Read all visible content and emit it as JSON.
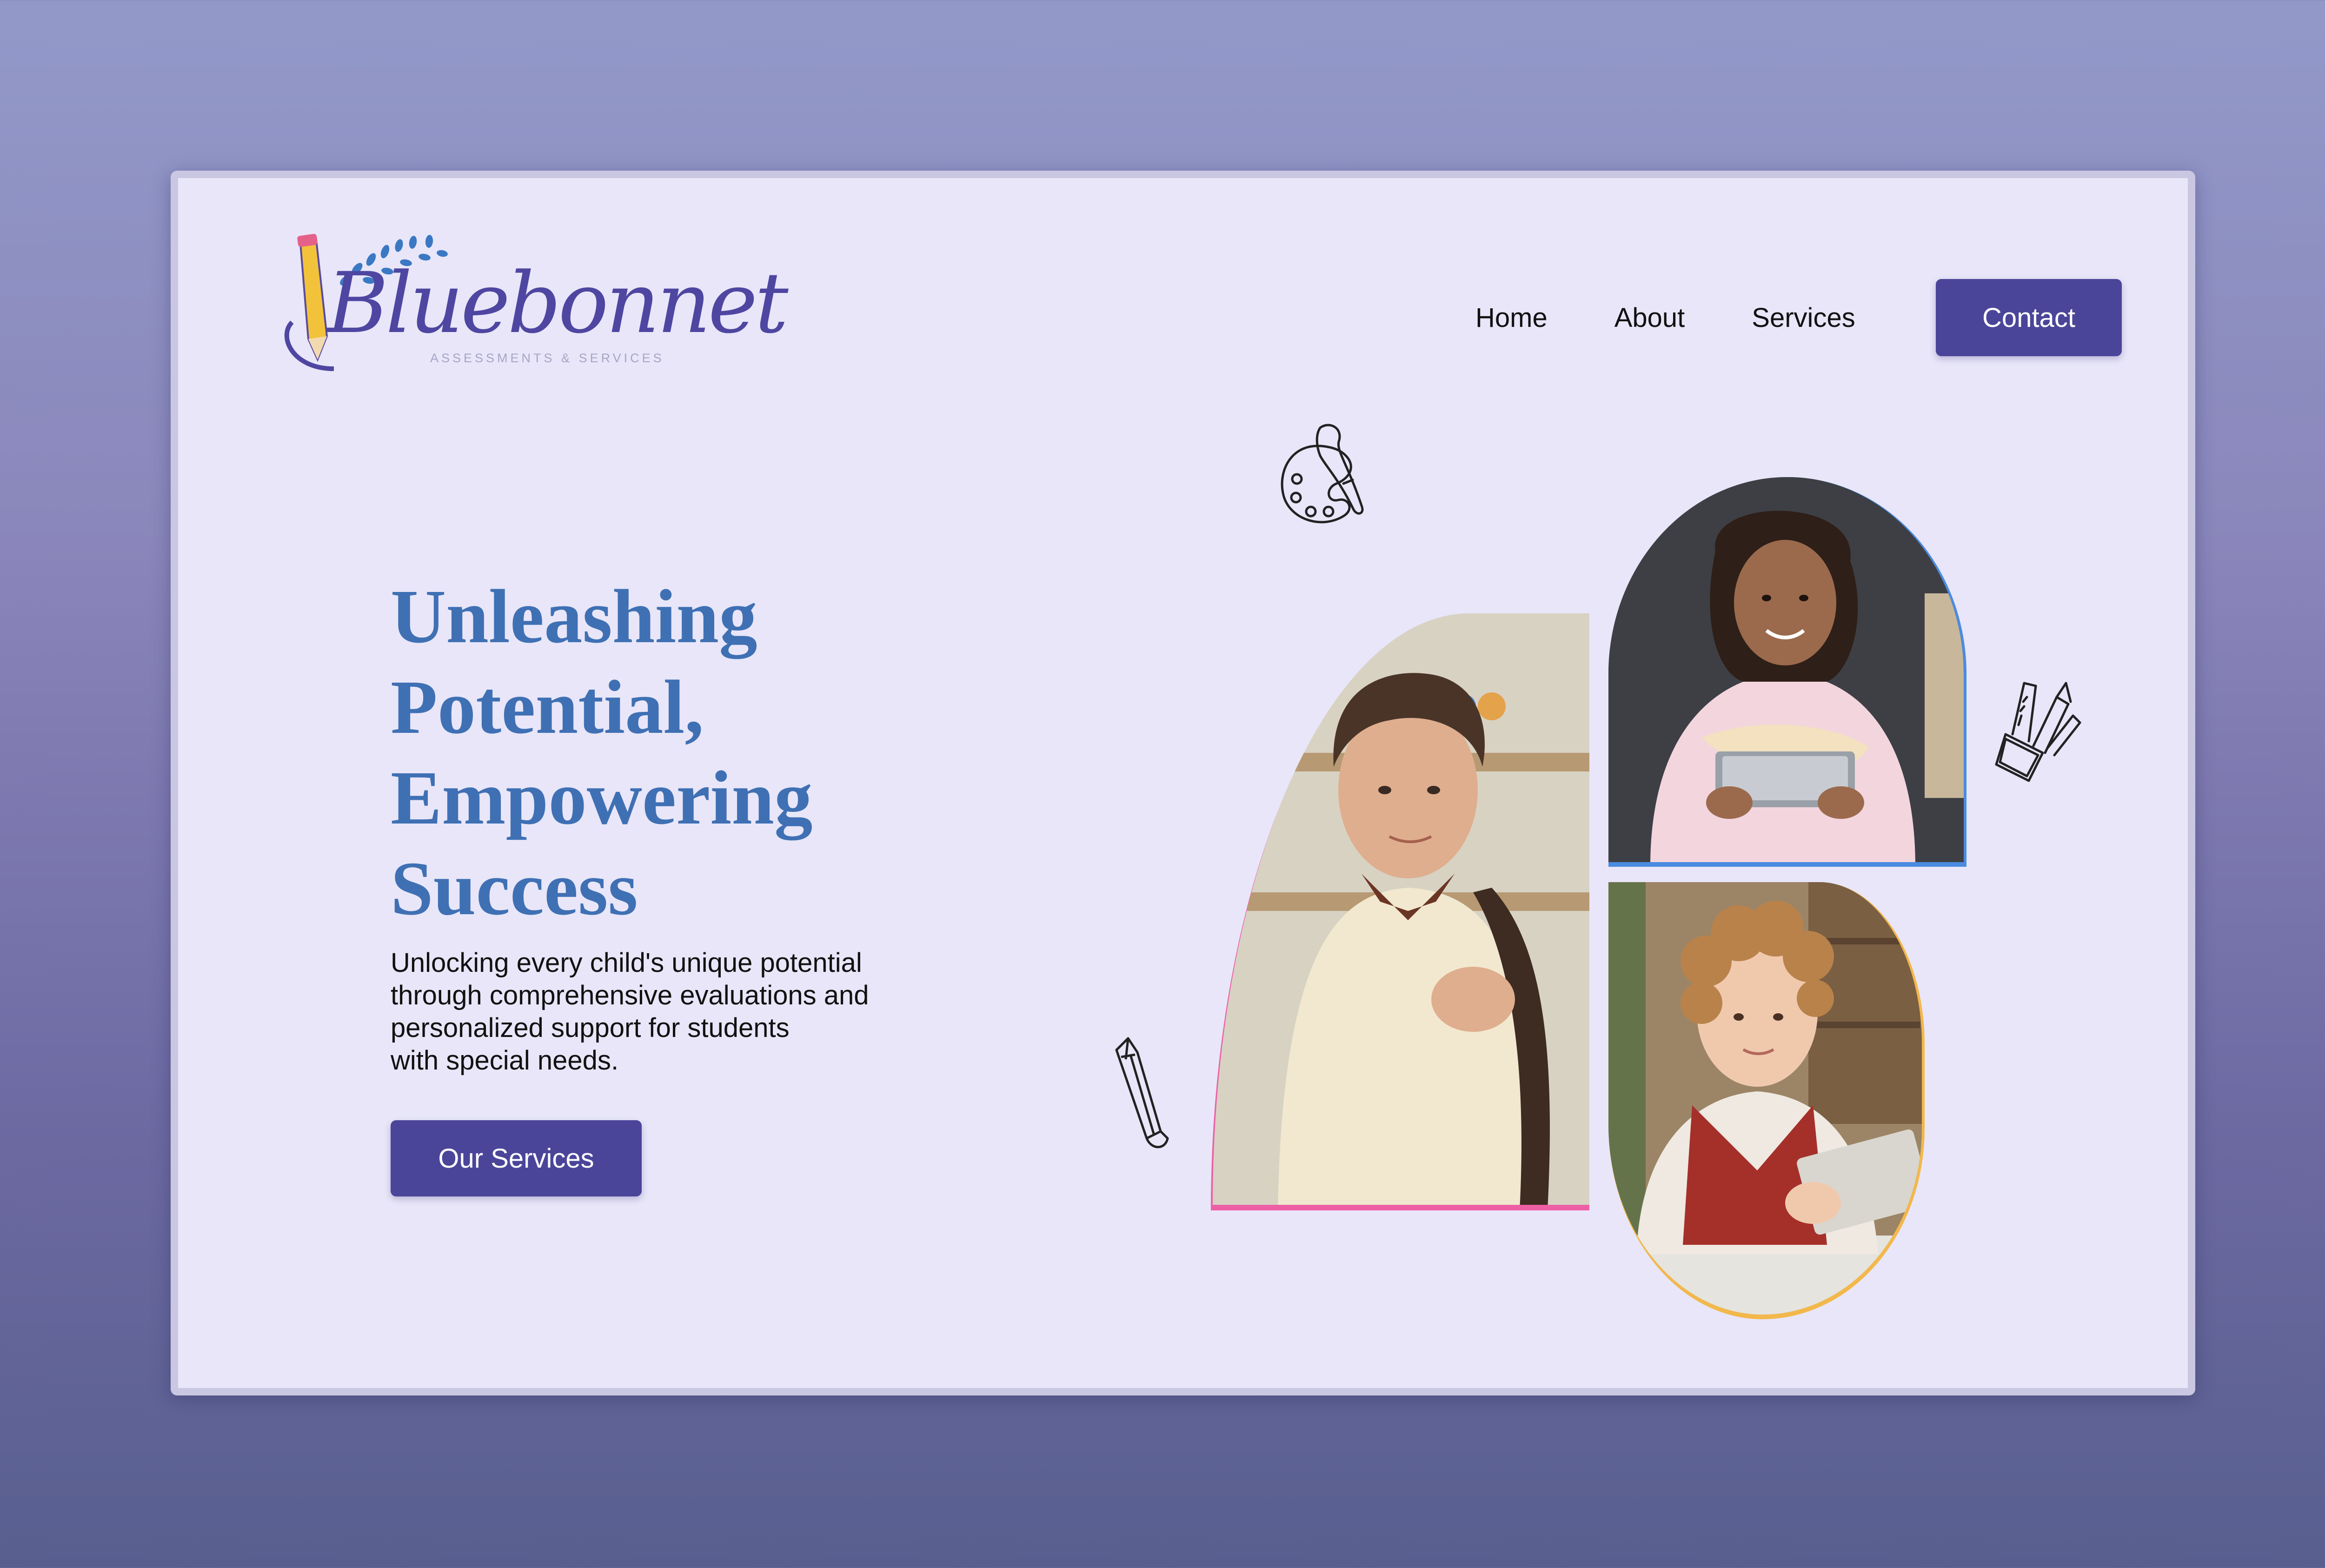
{
  "logo": {
    "wordmark": "Bluebonnet",
    "tagline": "ASSESSMENTS & SERVICES"
  },
  "nav": {
    "items": [
      {
        "label": "Home"
      },
      {
        "label": "About"
      },
      {
        "label": "Services"
      }
    ],
    "cta_label": "Contact"
  },
  "hero": {
    "title_lines": [
      "Unleashing",
      "Potential,",
      "Empowering",
      "Success"
    ],
    "subtitle_lines": [
      "Unlocking every child's unique potential",
      "through comprehensive evaluations and",
      "personalized support for students",
      "with special needs."
    ],
    "cta_label": "Our Services"
  },
  "images": [
    {
      "name": "boy-student-photo",
      "frame_color": "#ee5fa6"
    },
    {
      "name": "girl-tablet-photo",
      "frame_color": "#4a8be0"
    },
    {
      "name": "curly-kid-photo",
      "frame_color": "#f3b84b"
    }
  ],
  "icons": [
    "paint-palette-icon",
    "pencil-cup-icon",
    "pencil-icon",
    "pencil-logo-icon",
    "leaf-sprig-icon"
  ],
  "colors": {
    "brand": "#4b459a",
    "heading": "#3f70b4",
    "card_bg": "#e8e6f8"
  }
}
